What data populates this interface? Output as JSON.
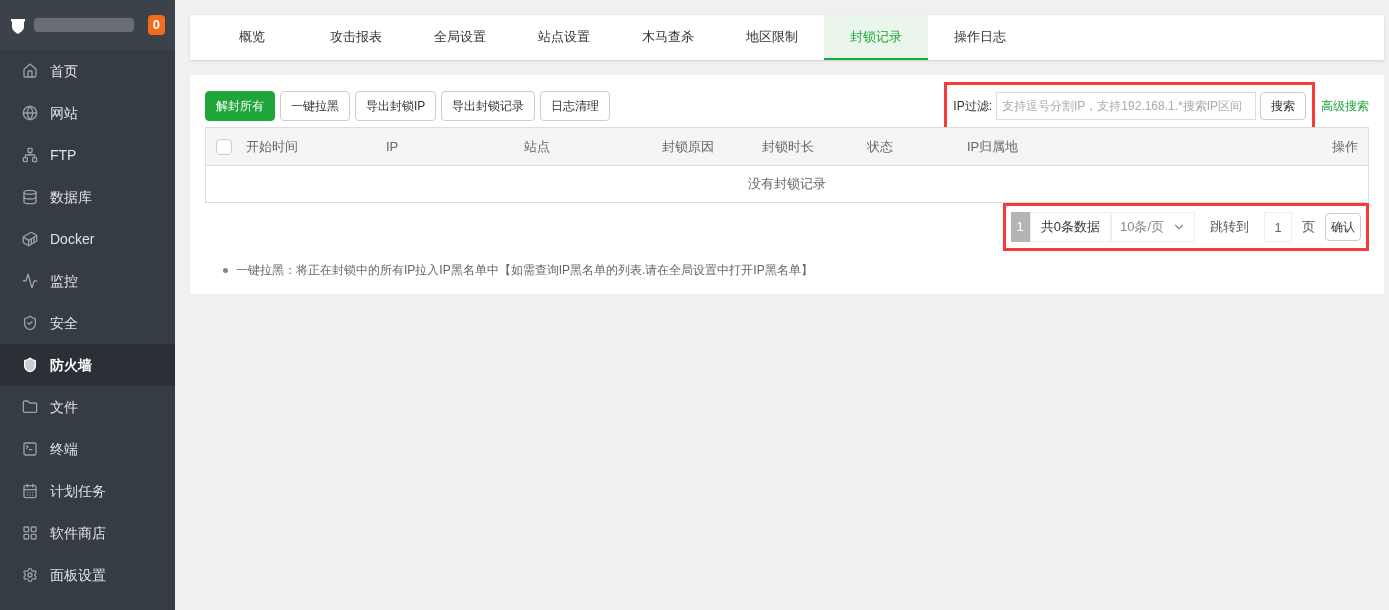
{
  "sidebar": {
    "badge": "0",
    "items": [
      {
        "label": "首页",
        "selected": false
      },
      {
        "label": "网站",
        "selected": false
      },
      {
        "label": "FTP",
        "selected": false
      },
      {
        "label": "数据库",
        "selected": false
      },
      {
        "label": "Docker",
        "selected": false
      },
      {
        "label": "监控",
        "selected": false
      },
      {
        "label": "安全",
        "selected": false
      },
      {
        "label": "防火墙",
        "selected": true
      },
      {
        "label": "文件",
        "selected": false
      },
      {
        "label": "终端",
        "selected": false
      },
      {
        "label": "计划任务",
        "selected": false
      },
      {
        "label": "软件商店",
        "selected": false
      },
      {
        "label": "面板设置",
        "selected": false
      }
    ]
  },
  "tabs": [
    {
      "label": "概览",
      "selected": false
    },
    {
      "label": "攻击报表",
      "selected": false
    },
    {
      "label": "全局设置",
      "selected": false
    },
    {
      "label": "站点设置",
      "selected": false
    },
    {
      "label": "木马查杀",
      "selected": false
    },
    {
      "label": "地区限制",
      "selected": false
    },
    {
      "label": "封锁记录",
      "selected": true
    },
    {
      "label": "操作日志",
      "selected": false
    }
  ],
  "toolbar": {
    "buttons": [
      {
        "label": "解封所有",
        "kind": "primary"
      },
      {
        "label": "一键拉黑",
        "kind": "default"
      },
      {
        "label": "导出封锁IP",
        "kind": "default"
      },
      {
        "label": "导出封锁记录",
        "kind": "default"
      },
      {
        "label": "日志清理",
        "kind": "default"
      }
    ],
    "filter_label": "IP过滤:",
    "filter_placeholder": "支持逗号分割IP，支持192.168.1.*搜索IP区间",
    "search_button": "搜索",
    "advanced_link": "高级搜索"
  },
  "table": {
    "select_all_checked": false,
    "columns": [
      "开始时间",
      "IP",
      "站点",
      "封锁原因",
      "封锁时长",
      "状态",
      "IP归属地",
      "操作"
    ],
    "empty_text": "没有封锁记录"
  },
  "pagination": {
    "current_page": "1",
    "total": "共0条数据",
    "page_size": "10条/页",
    "jump_label": "跳转到",
    "jump_value": "1",
    "page_unit": "页",
    "confirm": "确认"
  },
  "notes": [
    "一键拉黑：将正在封锁中的所有IP拉入IP黑名单中【如需查询IP黑名单的列表.请在全局设置中打开IP黑名单】"
  ]
}
